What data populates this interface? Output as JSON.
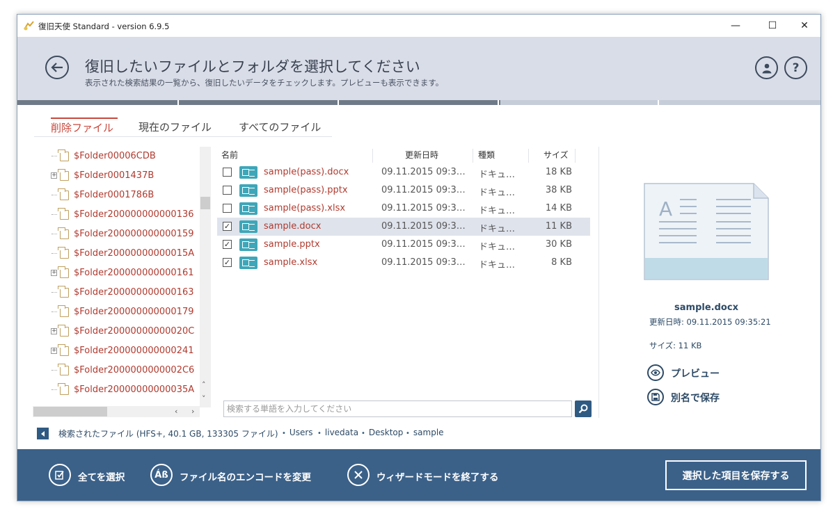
{
  "window": {
    "title": "復旧天使 Standard - version 6.9.5",
    "minimize": "—",
    "maximize": "☐",
    "close": "✕"
  },
  "header": {
    "title": "復旧したいファイルとフォルダを選択してください",
    "subtitle": "表示された検索結果の一覧から、復旧したいデータをチェックします。プレビューも表示できます。",
    "help_label": "?"
  },
  "progress": {
    "fraction": 0.6,
    "steps": 5
  },
  "tabs": [
    {
      "label": "削除ファイル",
      "active": true
    },
    {
      "label": "現在のファイル",
      "active": false
    },
    {
      "label": "すべてのファイル",
      "active": false
    }
  ],
  "tree": {
    "items": [
      {
        "name": "$Folder00006CDB",
        "expandable": false
      },
      {
        "name": "$Folder0001437B",
        "expandable": true
      },
      {
        "name": "$Folder0001786B",
        "expandable": false
      },
      {
        "name": "$Folder200000000000136",
        "expandable": false
      },
      {
        "name": "$Folder200000000000159",
        "expandable": false
      },
      {
        "name": "$Folder20000000000015A",
        "expandable": false
      },
      {
        "name": "$Folder200000000000161",
        "expandable": true
      },
      {
        "name": "$Folder200000000000163",
        "expandable": false
      },
      {
        "name": "$Folder200000000000179",
        "expandable": false
      },
      {
        "name": "$Folder20000000000020C",
        "expandable": true
      },
      {
        "name": "$Folder200000000000241",
        "expandable": true
      },
      {
        "name": "$Folder2000000000002C6",
        "expandable": false
      },
      {
        "name": "$Folder20000000000035A",
        "expandable": false
      }
    ]
  },
  "filelist": {
    "columns": {
      "name": "名前",
      "date": "更新日時",
      "type": "種類",
      "size": "サイズ"
    },
    "rows": [
      {
        "name": "sample(pass).docx",
        "date": "09.11.2015 09:3…",
        "type": "ドキュ…",
        "size": "18 KB",
        "checked": false,
        "selected": false
      },
      {
        "name": "sample(pass).pptx",
        "date": "09.11.2015 09:3…",
        "type": "ドキュ…",
        "size": "38 KB",
        "checked": false,
        "selected": false
      },
      {
        "name": "sample(pass).xlsx",
        "date": "09.11.2015 09:3…",
        "type": "ドキュ…",
        "size": "14 KB",
        "checked": false,
        "selected": false
      },
      {
        "name": "sample.docx",
        "date": "09.11.2015 09:3…",
        "type": "ドキュ…",
        "size": "11 KB",
        "checked": true,
        "selected": true
      },
      {
        "name": "sample.pptx",
        "date": "09.11.2015 09:3…",
        "type": "ドキュ…",
        "size": "30 KB",
        "checked": true,
        "selected": false
      },
      {
        "name": "sample.xlsx",
        "date": "09.11.2015 09:3…",
        "type": "ドキュ…",
        "size": "8 KB",
        "checked": true,
        "selected": false
      }
    ]
  },
  "search": {
    "placeholder": "検索する単語を入力してください"
  },
  "preview": {
    "file_name": "sample.docx",
    "modified": "更新日時: 09.11.2015 09:35:21",
    "size": "サイズ: 11 KB",
    "preview_label": "プレビュー",
    "save_as_label": "別名で保存"
  },
  "status": {
    "summary": "検索されたファイル (HFS+, 40.1 GB, 133305 ファイル)",
    "path": [
      "Users",
      "livedata",
      "Desktop",
      "sample"
    ]
  },
  "footer": {
    "select_all": "全てを選択",
    "change_encoding": "ファイル名のエンコードを変更",
    "exit_wizard": "ウィザードモードを終了する",
    "save_selected": "選択した項目を保存する",
    "encoding_icon_text": "Áß"
  },
  "colors": {
    "accent": "#c9473c",
    "header_bg": "#d9dde8",
    "footer_bg": "#3b6189",
    "file_icon": "#3ea6b8",
    "link": "#b03a2e"
  },
  "icons": [
    "app-icon",
    "back-arrow-icon",
    "user-icon",
    "help-icon",
    "folder-icon",
    "document-icon",
    "search-icon",
    "eye-icon",
    "floppy-disk-icon",
    "select-all-icon",
    "encoding-icon",
    "close-circle-icon"
  ]
}
